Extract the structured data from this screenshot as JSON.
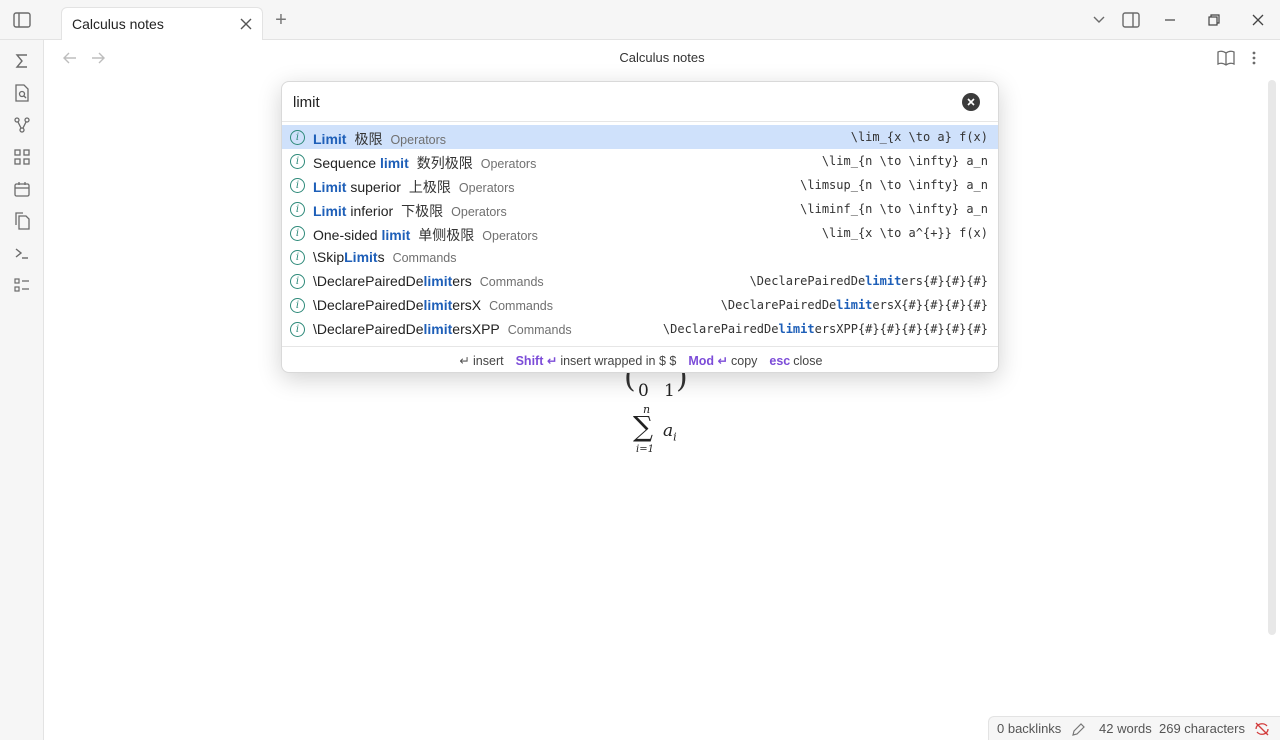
{
  "window": {
    "tab_title": "Calculus notes",
    "new_tab_symbol": "+"
  },
  "view": {
    "title": "Calculus notes"
  },
  "editor": {
    "matrix_bottom_row": [
      "0",
      "1"
    ],
    "sum_upper": "n",
    "sum_lower": "i=1",
    "sum_body": "a",
    "sum_body_sub": "i"
  },
  "search": {
    "value": "limit"
  },
  "results": [
    {
      "name_parts": [
        {
          "t": "Limit",
          "h": true
        }
      ],
      "cn": "极限",
      "category": "Operators",
      "code_parts": [
        {
          "t": "\\lim_{x \\to a} f(x)",
          "h": false
        }
      ],
      "selected": true
    },
    {
      "name_parts": [
        {
          "t": "Sequence ",
          "h": false
        },
        {
          "t": "limit",
          "h": true
        }
      ],
      "cn": "数列极限",
      "category": "Operators",
      "code_parts": [
        {
          "t": "\\lim_{n \\to \\infty} a_n",
          "h": false
        }
      ],
      "selected": false
    },
    {
      "name_parts": [
        {
          "t": "Limit",
          "h": true
        },
        {
          "t": " superior",
          "h": false
        }
      ],
      "cn": "上极限",
      "category": "Operators",
      "code_parts": [
        {
          "t": "\\limsup_{n \\to \\infty} a_n",
          "h": false
        }
      ],
      "selected": false
    },
    {
      "name_parts": [
        {
          "t": "Limit",
          "h": true
        },
        {
          "t": " inferior",
          "h": false
        }
      ],
      "cn": "下极限",
      "category": "Operators",
      "code_parts": [
        {
          "t": "\\liminf_{n \\to \\infty} a_n",
          "h": false
        }
      ],
      "selected": false
    },
    {
      "name_parts": [
        {
          "t": "One-sided ",
          "h": false
        },
        {
          "t": "limit",
          "h": true
        }
      ],
      "cn": "单侧极限",
      "category": "Operators",
      "code_parts": [
        {
          "t": "\\lim_{x \\to a^{+}} f(x)",
          "h": false
        }
      ],
      "selected": false
    },
    {
      "name_parts": [
        {
          "t": "\\Skip",
          "h": false
        },
        {
          "t": "Limit",
          "h": true
        },
        {
          "t": "s",
          "h": false
        }
      ],
      "cn": "",
      "category": "Commands",
      "code_parts": [],
      "selected": false
    },
    {
      "name_parts": [
        {
          "t": "\\DeclarePairedDe",
          "h": false
        },
        {
          "t": "limit",
          "h": true
        },
        {
          "t": "ers",
          "h": false
        }
      ],
      "cn": "",
      "category": "Commands",
      "code_parts": [
        {
          "t": "\\DeclarePairedDe",
          "h": false
        },
        {
          "t": "limit",
          "h": true
        },
        {
          "t": "ers{#}{#}{#}",
          "h": false
        }
      ],
      "selected": false
    },
    {
      "name_parts": [
        {
          "t": "\\DeclarePairedDe",
          "h": false
        },
        {
          "t": "limit",
          "h": true
        },
        {
          "t": "ersX",
          "h": false
        }
      ],
      "cn": "",
      "category": "Commands",
      "code_parts": [
        {
          "t": "\\DeclarePairedDe",
          "h": false
        },
        {
          "t": "limit",
          "h": true
        },
        {
          "t": "ersX{#}{#}{#}{#}",
          "h": false
        }
      ],
      "selected": false
    },
    {
      "name_parts": [
        {
          "t": "\\DeclarePairedDe",
          "h": false
        },
        {
          "t": "limit",
          "h": true
        },
        {
          "t": "ersXPP",
          "h": false
        }
      ],
      "cn": "",
      "category": "Commands",
      "code_parts": [
        {
          "t": "\\DeclarePairedDe",
          "h": false
        },
        {
          "t": "limit",
          "h": true
        },
        {
          "t": "ersXPP{#}{#}{#}{#}{#}{#}",
          "h": false
        }
      ],
      "selected": false
    }
  ],
  "footer": {
    "insert_key": "↵",
    "insert_label": "insert",
    "wrap_key": "Shift ↵",
    "wrap_label": "insert wrapped in $ $",
    "copy_key": "Mod ↵",
    "copy_label": "copy",
    "close_key": "esc",
    "close_label": "close"
  },
  "status": {
    "backlinks": "0 backlinks",
    "words": "42 words",
    "characters": "269 characters"
  },
  "colors": {
    "highlight": "#1e5fb8",
    "selected_row": "#cfe1fb",
    "key_accent": "#7c4cd8",
    "info_icon": "#2e8a7a"
  }
}
